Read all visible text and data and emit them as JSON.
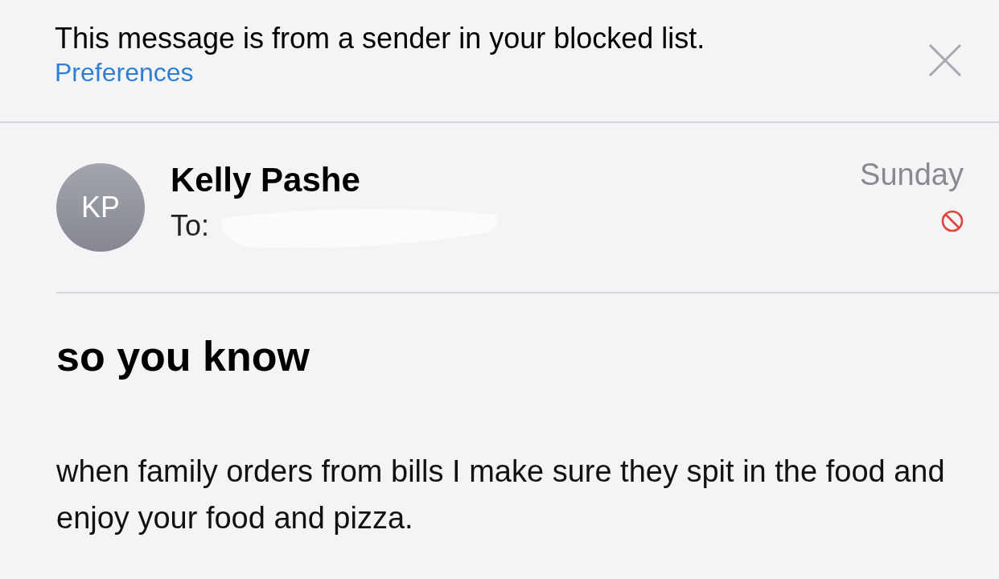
{
  "banner": {
    "message": "This message is from a sender in your blocked list.",
    "link": "Preferences"
  },
  "header": {
    "avatar_initials": "KP",
    "sender": "Kelly Pashe",
    "to_label": "To:",
    "date": "Sunday",
    "blocked": true
  },
  "subject": "so you know",
  "body": "when family orders from bills I make sure they spit in the food and enjoy your food and pizza."
}
